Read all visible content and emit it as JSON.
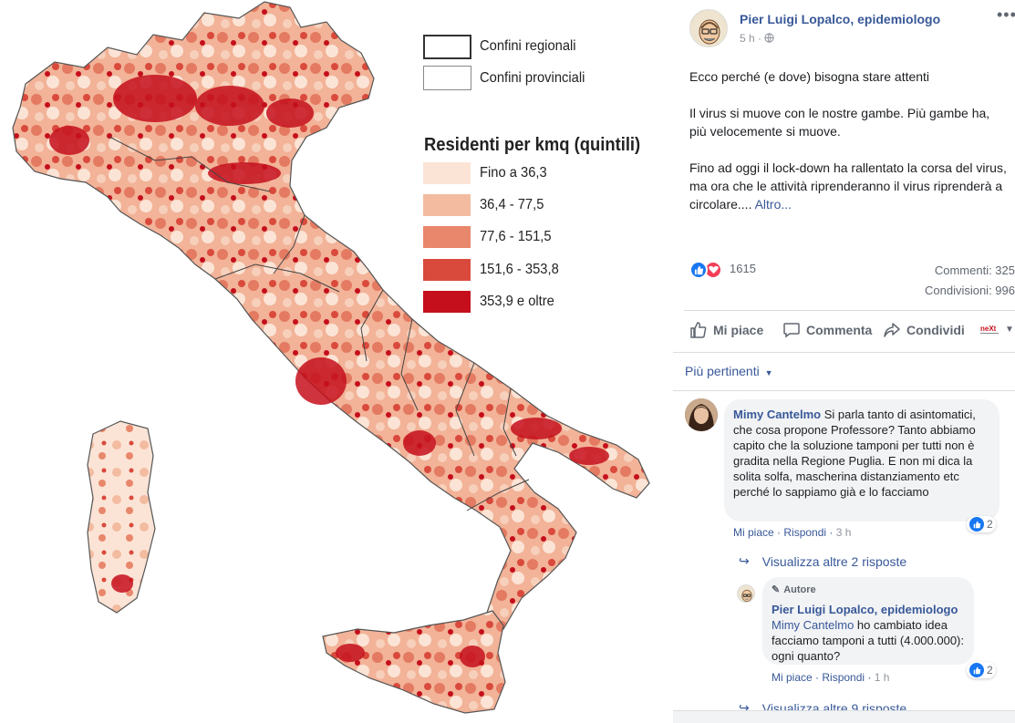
{
  "map": {
    "legend": {
      "boundaries": [
        {
          "label": "Confini regionali"
        },
        {
          "label": "Confini provinciali"
        }
      ],
      "title": "Residenti per kmq (quintili)",
      "classes": [
        {
          "label": "Fino a 36,3",
          "color": "#fbe4d6"
        },
        {
          "label": "36,4 - 77,5",
          "color": "#f3bca0"
        },
        {
          "label": "77,6 - 151,5",
          "color": "#e8876b"
        },
        {
          "label": "151,6 - 353,8",
          "color": "#d94a3c"
        },
        {
          "label": "353,9 e oltre",
          "color": "#c50f1c"
        }
      ]
    }
  },
  "post": {
    "author": "Pier Luigi Lopalco, epidemiologo",
    "time": "5 h",
    "more": "•••",
    "paragraphs": [
      "Ecco perché (e dove) bisogna stare attenti",
      "Il virus si muove con le nostre gambe. Più gambe ha, più velocemente si muove.",
      "Fino ad oggi il lock-down ha rallentato la corsa del virus, ma ora che le attività riprenderanno il virus riprenderà a circolare...."
    ],
    "see_more": "Altro...",
    "reactions_count": "1615",
    "comments_count": "Commenti: 325",
    "shares_count": "Condivisioni: 996",
    "actions": {
      "like": "Mi piace",
      "comment": "Commenta",
      "share": "Condividi"
    },
    "sort": "Più pertinenti",
    "comments": [
      {
        "name": "Mimy Cantelmo",
        "text": "Si parla tanto di asintomatici, che cosa propone Professore? Tanto abbiamo capito che la soluzione tamponi per tutti non è gradita nella Regione Puglia. E non mi dica la solita solfa, mascherina distanziamento etc perché lo sappiamo già e lo facciamo",
        "like": "Mi piace",
        "reply": "Rispondi",
        "time": "3 h",
        "likes": "2"
      }
    ],
    "view_replies_1": "Visualizza altre 2 risposte",
    "reply": {
      "badge": "Autore",
      "name": "Pier Luigi Lopalco, epidemiologo",
      "mention": "Mimy Cantelmo",
      "text": " ho cambiato idea facciamo tamponi a tutti (4.000.000): ogni quanto?",
      "like": "Mi piace",
      "reply": "Rispondi",
      "time": "1 h",
      "likes": "2"
    },
    "view_replies_2": "Visualizza altre 9 risposte"
  }
}
